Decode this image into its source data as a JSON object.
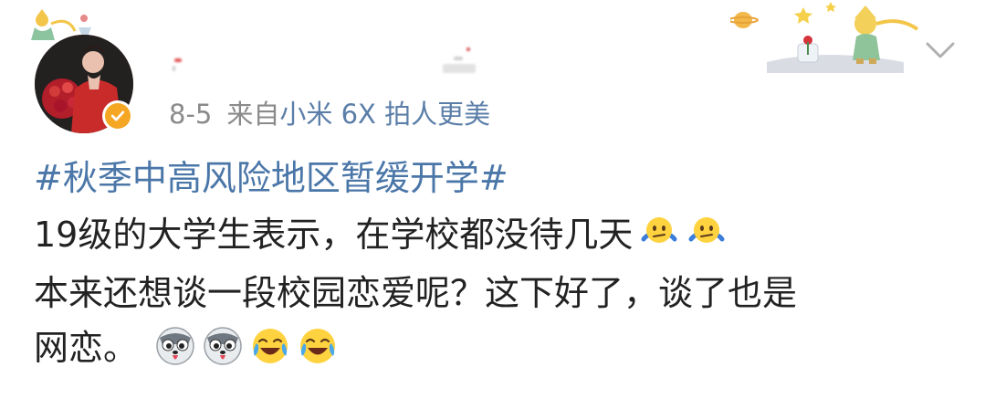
{
  "post": {
    "date": "8-5",
    "from_label": "来自",
    "device": "小米 6X 拍人更美",
    "topic": "#秋季中高风险地区暂缓开学#",
    "lines": [
      "19级的大学生表示，在学校都没待几天",
      "本来还想谈一段校园恋爱呢？这下好了，谈了也是",
      "网恋。"
    ]
  },
  "icons": {
    "verified": "verified-badge-icon",
    "chevron": "chevron-down-icon",
    "line1_emojis": [
      "shrug-emoji-icon",
      "shrug-emoji-icon"
    ],
    "line3_emojis": [
      "husky-dog-emoji-icon",
      "husky-dog-emoji-icon",
      "laugh-cry-emoji-icon",
      "laugh-cry-emoji-icon"
    ]
  },
  "colors": {
    "topic_link": "#4a76a8",
    "device_link": "#5b7ea8",
    "meta_gray": "#8a8a8a",
    "verified": "#f5a623"
  }
}
